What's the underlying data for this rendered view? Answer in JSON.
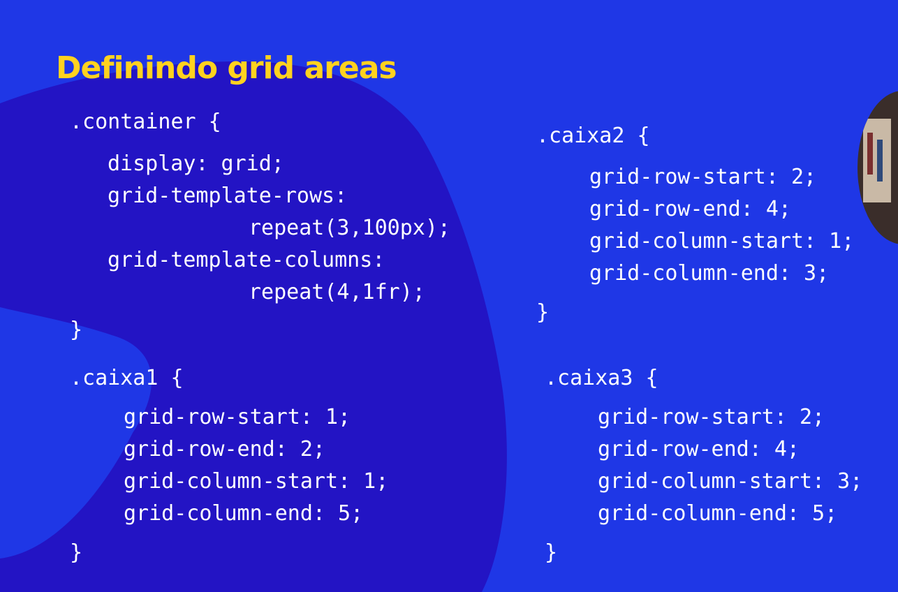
{
  "slide": {
    "title": "Definindo grid areas",
    "colors": {
      "background": "#1f37e6",
      "blob": "#2314c4",
      "title": "#ffd21f",
      "code": "#ffffff"
    },
    "blocks": {
      "container": [
        ".container {",
        "display: grid;",
        "grid-template-rows:",
        "repeat(3,100px);",
        "grid-template-columns:",
        "repeat(4,1fr);",
        "}"
      ],
      "caixa1": [
        ".caixa1 {",
        "grid-row-start: 1;",
        "grid-row-end: 2;",
        "grid-column-start: 1;",
        "grid-column-end: 5;",
        "}"
      ],
      "caixa2": [
        ".caixa2 {",
        "grid-row-start: 2;",
        "grid-row-end: 4;",
        "grid-column-start: 1;",
        "grid-column-end: 3;",
        "}"
      ],
      "caixa3": [
        ".caixa3 {",
        "grid-row-start: 2;",
        "grid-row-end: 4;",
        "grid-column-start: 3;",
        "grid-column-end: 5;",
        "}"
      ]
    }
  }
}
